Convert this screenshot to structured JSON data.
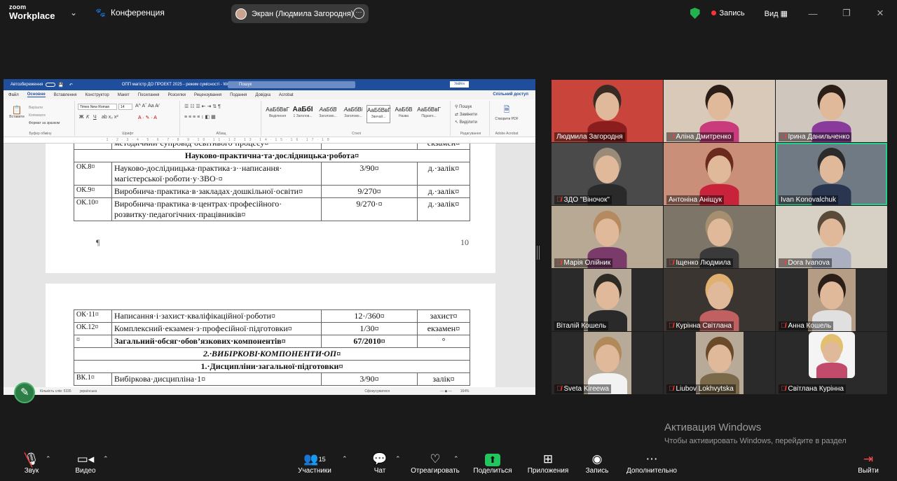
{
  "app": {
    "logo_top": "zoom",
    "logo_bottom": "Workplace",
    "meeting": "Конференция"
  },
  "share_pill": {
    "label": "Экран (Людмила Загородня)"
  },
  "top_right": {
    "record": "Запись",
    "view": "Вид"
  },
  "word": {
    "autosave": "Автозбереження",
    "doc_title": "ОПП магістр ДО ПРОЕКТ 2025  -  режим сумісності  -  Word",
    "search": "Пошук",
    "signin": "Увійти",
    "tabs": [
      "Файл",
      "Основне",
      "Вставлення",
      "Конструктор",
      "Макет",
      "Посилання",
      "Розсилки",
      "Рецензування",
      "Подання",
      "Довідка",
      "Acrobat"
    ],
    "share": "Спільний доступ",
    "ribbon": {
      "paste": "Вставити",
      "cut": "Вирізати",
      "copy": "Копіювати",
      "format_painter": "Формат за зразком",
      "clipboard": "Буфер обміну",
      "font_name": "Times New Roman",
      "font_size": "14",
      "font_group": "Шрифт",
      "paragraph_group": "Абзац",
      "styles_group": "Стилі",
      "styles": [
        {
          "sample": "АаБбВвГ",
          "name": "Виділення"
        },
        {
          "sample": "АаБбІ",
          "name": "1 Заголов..."
        },
        {
          "sample": "АаБбВ",
          "name": "Заголово..."
        },
        {
          "sample": "АаБбВі",
          "name": "Заголово..."
        },
        {
          "sample": "АаБбВвГ",
          "name": "Звичай..."
        },
        {
          "sample": "АаБбВ",
          "name": "Назва"
        },
        {
          "sample": "АаБбВвГ",
          "name": "Підзаго..."
        }
      ],
      "find": "Пошук",
      "replace": "Замінити",
      "select": "Виділити",
      "editing_group": "Редагування",
      "create_pdf": "Створити PDF",
      "acrobat_group": "Adobe Acrobat"
    },
    "status": {
      "words": "Кількість слів: 5335",
      "lang": "українська",
      "focus": "Сфокусуватися",
      "zoom": "164%"
    }
  },
  "doc": {
    "page1_rows": [
      {
        "code": "",
        "name": "методичний·супровід·освітнього·процесу¤",
        "credits": "",
        "control": "екзамен¤"
      },
      {
        "section": "Науково-практична·та·дослідницька·робота¤"
      },
      {
        "code": "ОК.8¤",
        "name": "Науково-дослідницька·практика·з··написання· магістерської·роботи·у·ЗВО·¤",
        "credits": "3/90¤",
        "control": "д.·залік¤"
      },
      {
        "code": "ОК.9¤",
        "name": "Виробнича·практика·в·закладах·дошкільної·освіти¤",
        "credits": "9/270¤",
        "control": "д.·залік¤"
      },
      {
        "code": "ОК.10¤",
        "name": "Виробнича·практика·в·центрах·професійного· розвитку·педагогічних·працівників¤",
        "credits": "9/270·¤",
        "control": "д.·залік¤"
      }
    ],
    "page_mark": "¶",
    "page_number": "10",
    "page2_rows": [
      {
        "code": "ОК·11¤",
        "name": "Написання·і·захист·кваліфікаційної·роботи¤",
        "credits": "12·/360¤",
        "control": "захист¤"
      },
      {
        "code": "ОК.12¤",
        "name": "Комплексний·екзамен·з·професійної·підготовки¤",
        "credits": "1/30¤",
        "control": "екзамен¤"
      },
      {
        "code": "¤",
        "name": "Загальний·обсяг·обов’язкових·компонентів¤",
        "credits": "67/2010¤",
        "control": "°"
      },
      {
        "section": "2.·ВИБІРКОВІ·КОМПОНЕНТИ·ОП¤"
      },
      {
        "section": "1.·Дисципліни·загальної·підготовки¤"
      },
      {
        "code": "ВК.1¤",
        "name": "Вибіркова·дисципліна·1¤",
        "credits": "3/90¤",
        "control": "залік¤"
      }
    ]
  },
  "participants": [
    {
      "name": "Людмила Загородня",
      "muted": false
    },
    {
      "name": "Аліна Дмитренко",
      "muted": true
    },
    {
      "name": "Ірина Данильченко",
      "muted": true
    },
    {
      "name": "ЗДО \"Віночок\"",
      "muted": true
    },
    {
      "name": "Антоніна Аніщук",
      "muted": false
    },
    {
      "name": "Ivan Konovalchuk",
      "muted": false
    },
    {
      "name": "Марія Олійник",
      "muted": true
    },
    {
      "name": "Іщенко Людмила",
      "muted": true
    },
    {
      "name": "Dora Ivanova",
      "muted": true
    },
    {
      "name": "Віталій Кошель",
      "muted": false
    },
    {
      "name": "Курінна Світлана",
      "muted": true
    },
    {
      "name": "Анна Кошель",
      "muted": true
    },
    {
      "name": "Sveta Kireewa",
      "muted": true
    },
    {
      "name": "Liubov Lokhvytska",
      "muted": true
    },
    {
      "name": "Світлана Курінна",
      "muted": true
    }
  ],
  "activation": {
    "title": "Активация Windows",
    "text": "Чтобы активировать Windows, перейдите в раздел \"Параметры\"."
  },
  "toolbar": {
    "audio": "Звук",
    "video": "Видео",
    "participants": "Участники",
    "participants_count": "15",
    "chat": "Чат",
    "react": "Отреагировать",
    "share": "Поделиться",
    "apps": "Приложения",
    "record": "Запись",
    "more": "Дополнительно",
    "leave": "Выйти"
  },
  "colors": {
    "word_blue": "#1f4e9c",
    "share_green": "#22c55e",
    "active_speaker": "#23d18b",
    "muted_red": "#ff3b3b"
  }
}
